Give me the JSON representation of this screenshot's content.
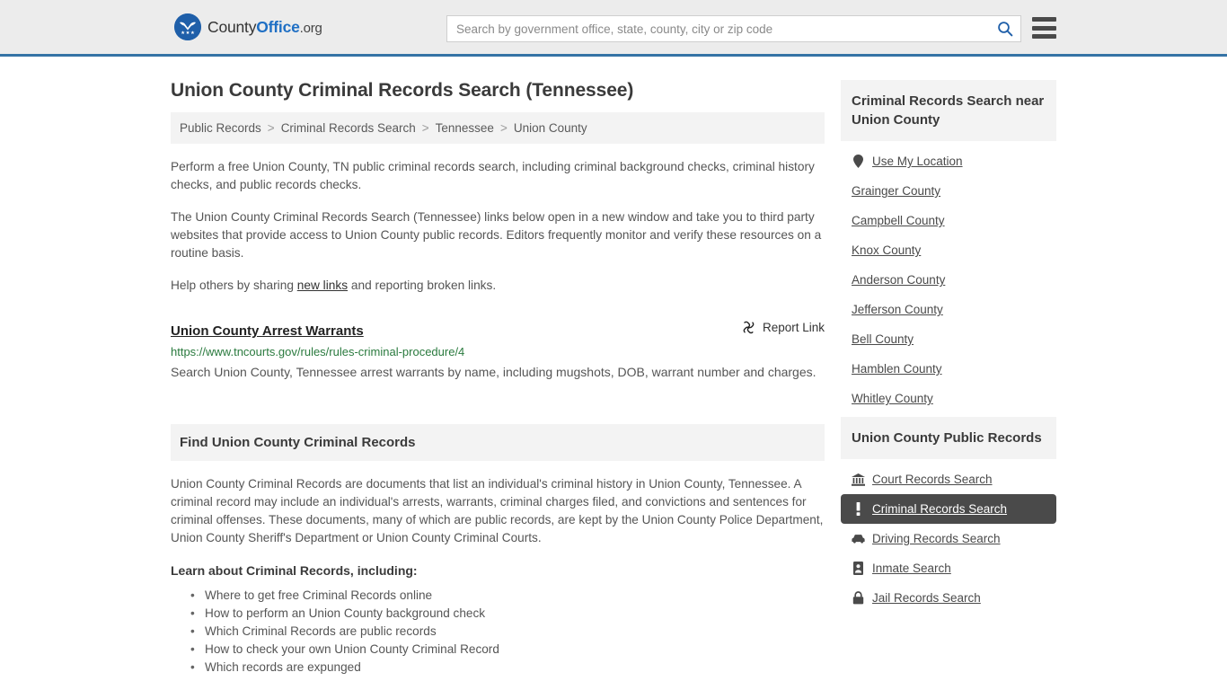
{
  "header": {
    "logo": {
      "part1": "County",
      "part2": "Office",
      "part3": ".org",
      "icon": "eagle-stars-seal-icon"
    },
    "search": {
      "placeholder": "Search by government office, state, county, city or zip code",
      "value": "",
      "search_icon": "search-icon"
    },
    "menu_icon": "hamburger-menu-icon"
  },
  "page": {
    "title": "Union County Criminal Records Search (Tennessee)"
  },
  "breadcrumb": {
    "separator": ">",
    "items": [
      {
        "label": "Public Records"
      },
      {
        "label": "Criminal Records Search"
      },
      {
        "label": "Tennessee"
      },
      {
        "label": "Union County"
      }
    ]
  },
  "intro": {
    "p1": "Perform a free Union County, TN public criminal records search, including criminal background checks, criminal history checks, and public records checks.",
    "p2": "The Union County Criminal Records Search (Tennessee) links below open in a new window and take you to third party websites that provide access to Union County public records. Editors frequently monitor and verify these resources on a routine basis.",
    "p3_before": "Help others by sharing ",
    "p3_link": "new links",
    "p3_after": " and reporting broken links."
  },
  "result": {
    "title": "Union County Arrest Warrants",
    "report_label": "Report Link",
    "report_icon": "broken-link-icon",
    "url": "https://www.tncourts.gov/rules/rules-criminal-procedure/4",
    "description": "Search Union County, Tennessee arrest warrants by name, including mugshots, DOB, warrant number and charges."
  },
  "find_section": {
    "heading": "Find Union County Criminal Records",
    "paragraph": "Union County Criminal Records are documents that list an individual's criminal history in Union County, Tennessee. A criminal record may include an individual's arrests, warrants, criminal charges filed, and convictions and sentences for criminal offenses. These documents, many of which are public records, are kept by the Union County Police Department, Union County Sheriff's Department or Union County Criminal Courts.",
    "lead_in": "Learn about Criminal Records, including:",
    "bullets": [
      "Where to get free Criminal Records online",
      "How to perform an Union County background check",
      "Which Criminal Records are public records",
      "How to check your own Union County Criminal Record",
      "Which records are expunged"
    ]
  },
  "sidebar": {
    "nearby": {
      "heading": "Criminal Records Search near Union County",
      "items": [
        {
          "label": "Use My Location",
          "icon": "map-pin-icon",
          "has_icon": true
        },
        {
          "label": "Grainger County",
          "icon": "",
          "has_icon": false
        },
        {
          "label": "Campbell County",
          "icon": "",
          "has_icon": false
        },
        {
          "label": "Knox County",
          "icon": "",
          "has_icon": false
        },
        {
          "label": "Anderson County",
          "icon": "",
          "has_icon": false
        },
        {
          "label": "Jefferson County",
          "icon": "",
          "has_icon": false
        },
        {
          "label": "Bell County",
          "icon": "",
          "has_icon": false
        },
        {
          "label": "Hamblen County",
          "icon": "",
          "has_icon": false
        },
        {
          "label": "Whitley County",
          "icon": "",
          "has_icon": false
        }
      ]
    },
    "public_records": {
      "heading": "Union County Public Records",
      "items": [
        {
          "label": "Court Records Search",
          "icon": "courthouse-icon",
          "active": false
        },
        {
          "label": "Criminal Records Search",
          "icon": "exclamation-icon",
          "active": true
        },
        {
          "label": "Driving Records Search",
          "icon": "car-icon",
          "active": false
        },
        {
          "label": "Inmate Search",
          "icon": "id-card-icon",
          "active": false
        },
        {
          "label": "Jail Records Search",
          "icon": "lock-icon",
          "active": false
        }
      ]
    }
  },
  "colors": {
    "brand_blue": "#1f6fc4",
    "header_border": "#3573a5",
    "header_bg": "#ececec",
    "panel_bg": "#f3f3f3",
    "active_bg": "#4a4a4a",
    "url_green": "#2a7a3e",
    "text_gray": "#555555"
  }
}
